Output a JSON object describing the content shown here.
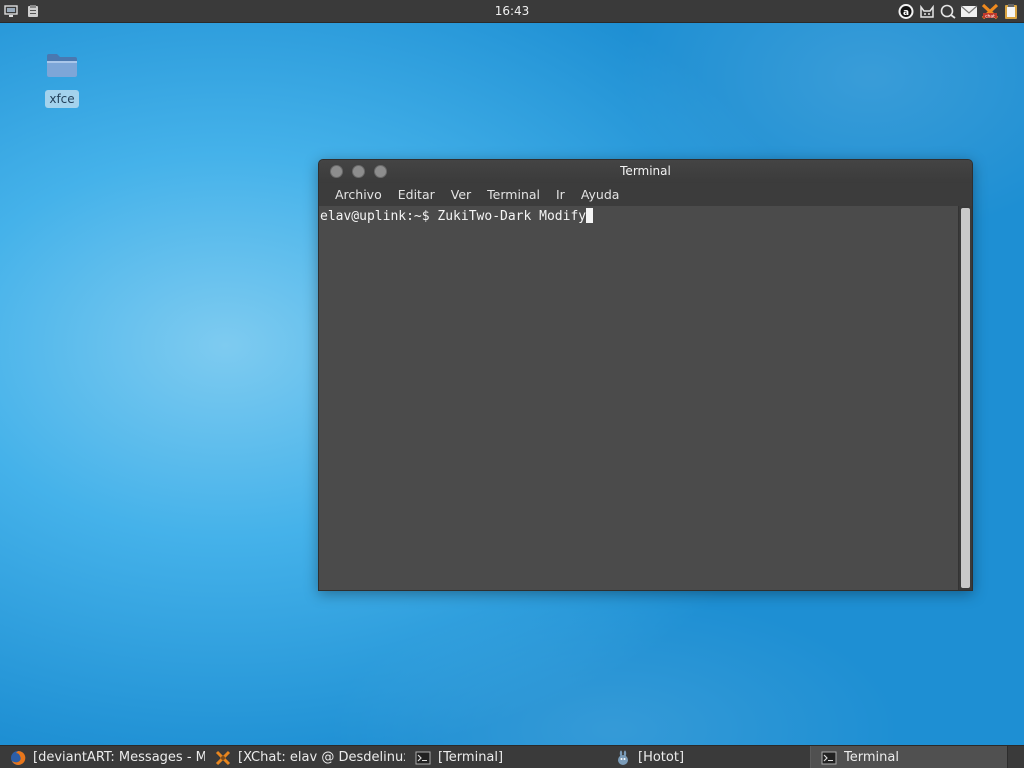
{
  "top_panel": {
    "clock": "16:43",
    "left_icons": [
      "monitor-icon",
      "clipboard-app-icon"
    ],
    "tray_icons": [
      "pidgin-a-icon",
      "cat-icon",
      "chat-bubble-icon",
      "mail-icon",
      "xchat-icon",
      "clipboard-icon"
    ]
  },
  "desktop": {
    "icons": [
      {
        "label": "xfce",
        "icon": "folder-icon"
      }
    ]
  },
  "terminal": {
    "title": "Terminal",
    "menu": [
      "Archivo",
      "Editar",
      "Ver",
      "Terminal",
      "Ir",
      "Ayuda"
    ],
    "prompt": "elav@uplink:~$ ",
    "command": "ZukiTwo-Dark Modify"
  },
  "taskbar": {
    "tasks": [
      {
        "label": "[deviantART: Messages - M...",
        "icon": "firefox-icon",
        "active": false
      },
      {
        "label": "[XChat: elav @ Desdelinux /...",
        "icon": "xchat-icon",
        "active": false
      },
      {
        "label": "[Terminal]",
        "icon": "terminal-icon",
        "active": false
      },
      {
        "label": "[Hotot]",
        "icon": "hotot-icon",
        "active": false
      },
      {
        "label": "Terminal",
        "icon": "terminal-icon",
        "active": true
      }
    ]
  },
  "colors": {
    "panel": "#3a3a3a",
    "terminal_bg": "#4b4b4b",
    "wallpaper": "#3aa8e6"
  }
}
